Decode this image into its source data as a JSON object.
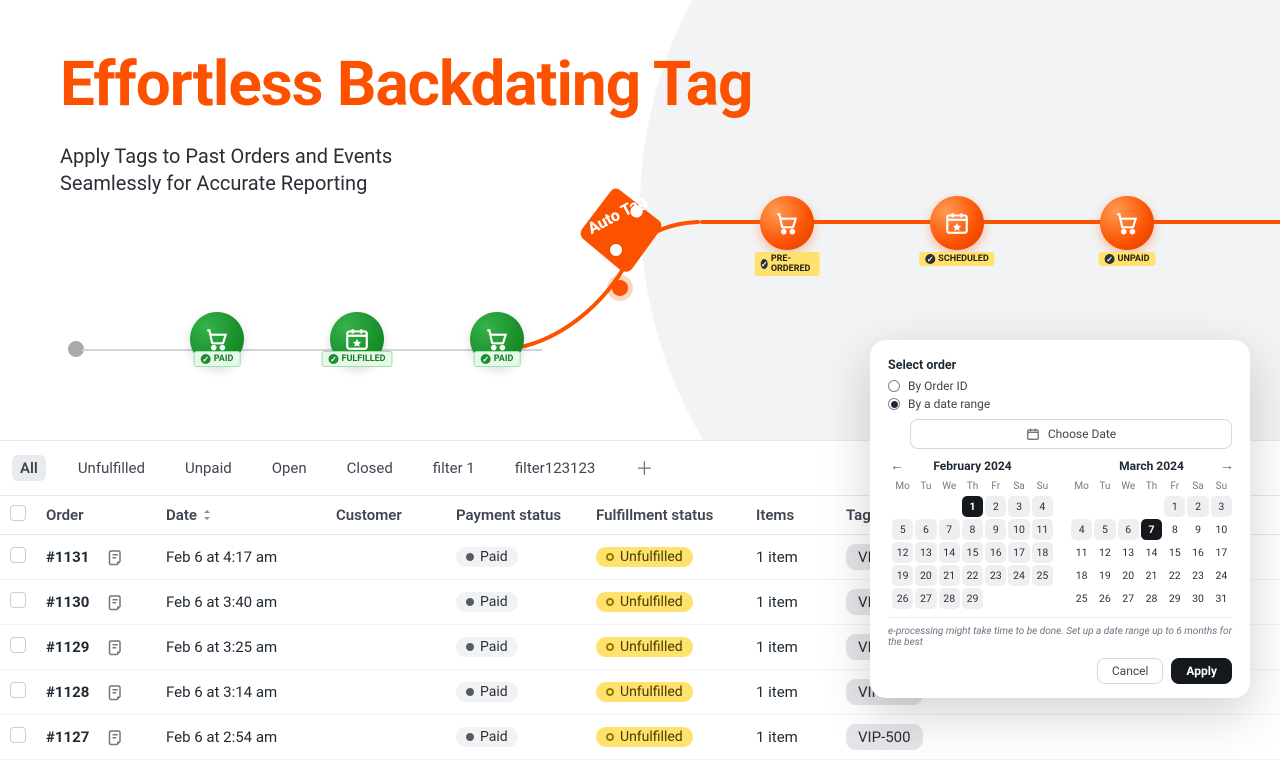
{
  "hero": {
    "title": "Effortless Backdating Tag",
    "subtitle": "Apply Tags to Past Orders and Events Seamlessly for Accurate Reporting"
  },
  "autotag": {
    "label": "Auto Tag"
  },
  "timeline": {
    "past": [
      {
        "icon": "cart",
        "badge": "PAID"
      },
      {
        "icon": "calendar",
        "badge": "FULFILLED"
      },
      {
        "icon": "cart",
        "badge": "PAID"
      }
    ],
    "future": [
      {
        "icon": "cart",
        "badge": "PRE-ORDERED"
      },
      {
        "icon": "calendar",
        "badge": "SCHEDULED"
      },
      {
        "icon": "cart",
        "badge": "UNPAID"
      }
    ]
  },
  "tabs": [
    "All",
    "Unfulfilled",
    "Unpaid",
    "Open",
    "Closed",
    "filter 1",
    "filter123123"
  ],
  "table": {
    "headers": {
      "order": "Order",
      "date": "Date",
      "customer": "Customer",
      "payment": "Payment status",
      "fulfil": "Fulfillment status",
      "items": "Items",
      "tags": "Tags"
    },
    "rows": [
      {
        "id": "#1131",
        "date": "Feb 6 at 4:17 am",
        "payment": "Paid",
        "fulfil": "Unfulfilled",
        "items": "1 item",
        "tag": "VIP-500"
      },
      {
        "id": "#1130",
        "date": "Feb 6 at 3:40 am",
        "payment": "Paid",
        "fulfil": "Unfulfilled",
        "items": "1 item",
        "tag": "VIP-500"
      },
      {
        "id": "#1129",
        "date": "Feb 6 at 3:25 am",
        "payment": "Paid",
        "fulfil": "Unfulfilled",
        "items": "1 item",
        "tag": "VIP-500"
      },
      {
        "id": "#1128",
        "date": "Feb 6 at 3:14 am",
        "payment": "Paid",
        "fulfil": "Unfulfilled",
        "items": "1 item",
        "tag": "VIP-500"
      },
      {
        "id": "#1127",
        "date": "Feb 6 at 2:54 am",
        "payment": "Paid",
        "fulfil": "Unfulfilled",
        "items": "1 item",
        "tag": "VIP-500"
      }
    ]
  },
  "panel": {
    "title": "Select order",
    "radio1": "By Order ID",
    "radio2": "By a date range",
    "choose": "Choose Date",
    "months": {
      "feb": "February 2024",
      "mar": "March 2024"
    },
    "dow": [
      "Mo",
      "Tu",
      "We",
      "Th",
      "Fr",
      "Sa",
      "Su"
    ],
    "note": "e-processing might take time to be done. Set up a date range up to 6 months for the best",
    "cancel": "Cancel",
    "apply": "Apply",
    "range_start": "2024-02-01",
    "range_end": "2024-03-07"
  }
}
